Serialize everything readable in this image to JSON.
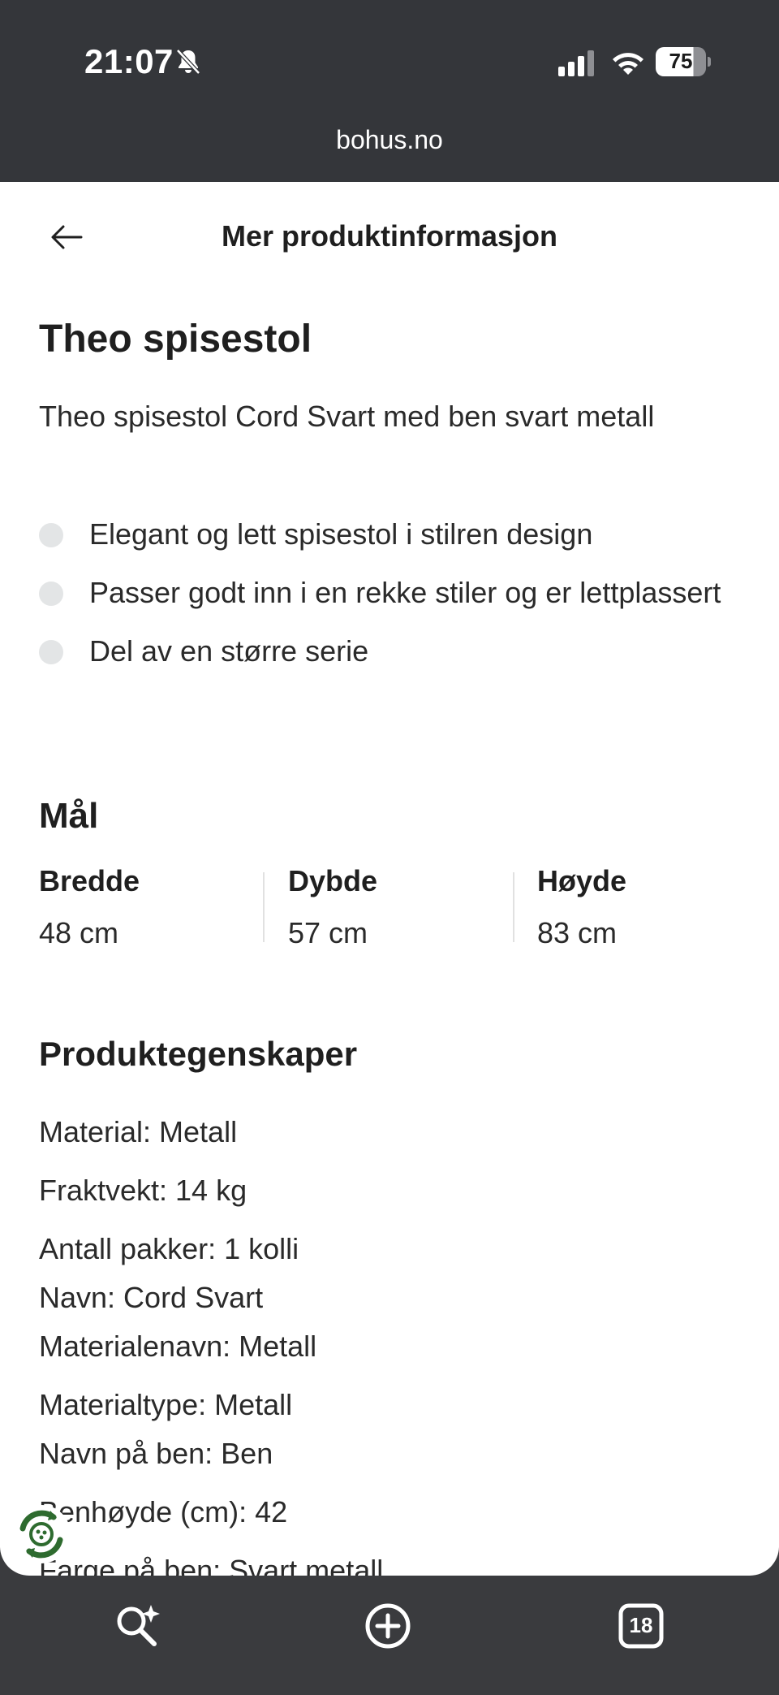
{
  "status_bar": {
    "time": "21:07",
    "battery": "75",
    "battery_level": 0.75
  },
  "browser": {
    "url": "bohus.no"
  },
  "header": {
    "title": "Mer produktinformasjon"
  },
  "product": {
    "title": "Theo spisestol",
    "subtitle": "Theo spisestol Cord Svart med ben svart metall",
    "bullets": [
      "Elegant og lett spisestol i stilren design",
      "Passer godt inn i en rekke stiler og er lettplassert",
      "Del av en større serie"
    ]
  },
  "dimensions": {
    "title": "Mål",
    "items": [
      {
        "label": "Bredde",
        "value": "48 cm"
      },
      {
        "label": "Dybde",
        "value": "57 cm"
      },
      {
        "label": "Høyde",
        "value": "83 cm"
      }
    ]
  },
  "properties": {
    "title": "Produktegenskaper",
    "items": [
      "Material: Metall",
      "Fraktvekt: 14 kg",
      "Antall pakker: 1 kolli",
      "Navn: Cord Svart",
      "Materialenavn: Metall",
      "Materialtype: Metall",
      "Navn på ben: Ben",
      "Benhøyde (cm): 42",
      "Farge på ben: Svart metall"
    ]
  },
  "toolbar": {
    "tabs_count": "18"
  },
  "colors": {
    "background": "#3a3b3e",
    "sheet": "#ffffff",
    "text": "#1f1f1f",
    "bullet_dot": "#e3e5e6",
    "recycle_green": "#2e6b2f"
  }
}
